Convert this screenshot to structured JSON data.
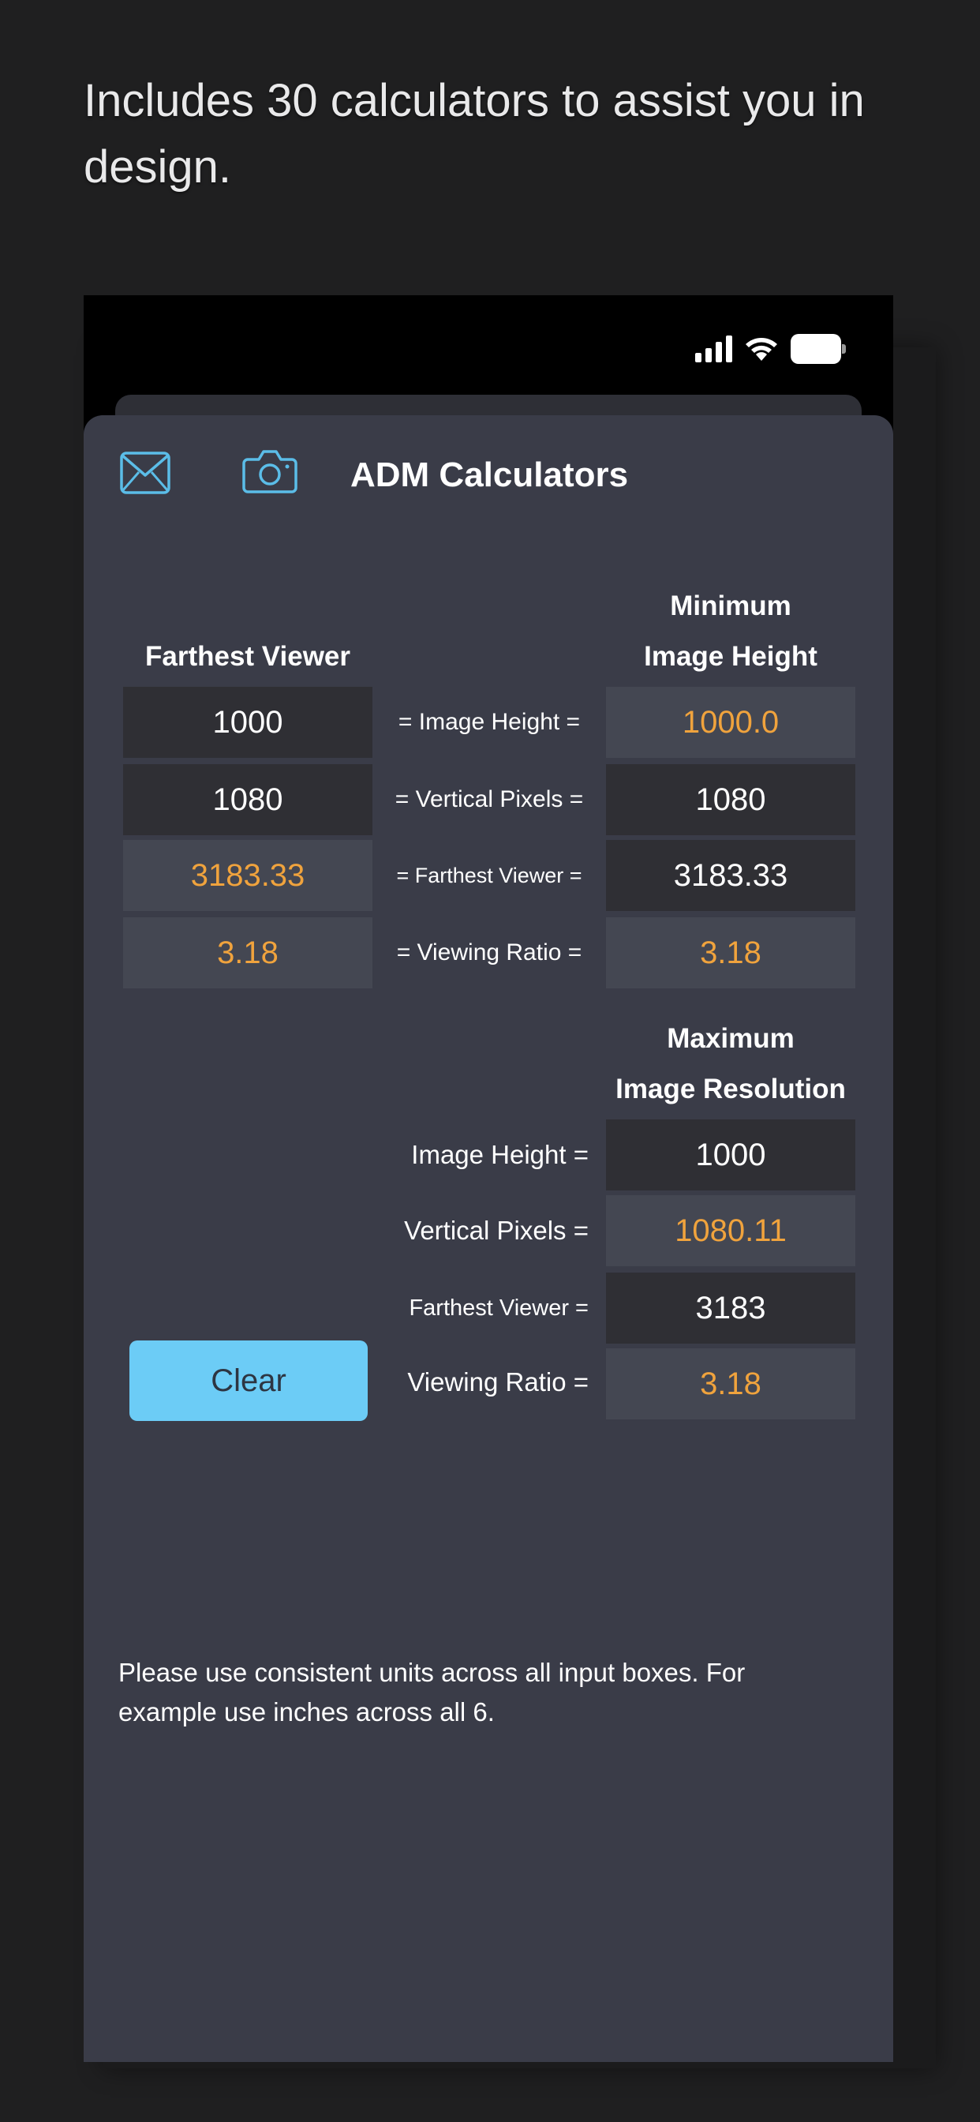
{
  "promo": {
    "headline": "Includes 30 calculators to assist you in design."
  },
  "app": {
    "title": "ADM Calculators"
  },
  "minimum_section": {
    "left_header": "Farthest Viewer",
    "right_header_line1": "Minimum",
    "right_header_line2": "Image Height",
    "rows": [
      {
        "left": "1000",
        "label": "= Image Height =",
        "right": "1000.0"
      },
      {
        "left": "1080",
        "label": "= Vertical Pixels =",
        "right": "1080"
      },
      {
        "left": "3183.33",
        "label": "= Farthest Viewer =",
        "right": "3183.33"
      },
      {
        "left": "3.18",
        "label": "= Viewing Ratio =",
        "right": "3.18"
      }
    ]
  },
  "maximum_section": {
    "header_line1": "Maximum",
    "header_line2": "Image Resolution",
    "rows": [
      {
        "label": "Image Height =",
        "value": "1000"
      },
      {
        "label": "Vertical Pixels =",
        "value": "1080.11"
      },
      {
        "label": "Farthest Viewer =",
        "value": "3183"
      },
      {
        "label": "Viewing Ratio =",
        "value": "3.18"
      }
    ]
  },
  "clear_button": "Clear",
  "note": "Please use consistent units across all input boxes. For example use inches across all 6.",
  "colors": {
    "accent_orange": "#f0a33d",
    "accent_blue": "#6cccf6",
    "sheet_bg": "#3a3c48"
  },
  "icons": [
    "mail-icon",
    "camera-icon",
    "cellular-signal-icon",
    "wifi-icon",
    "battery-icon"
  ]
}
